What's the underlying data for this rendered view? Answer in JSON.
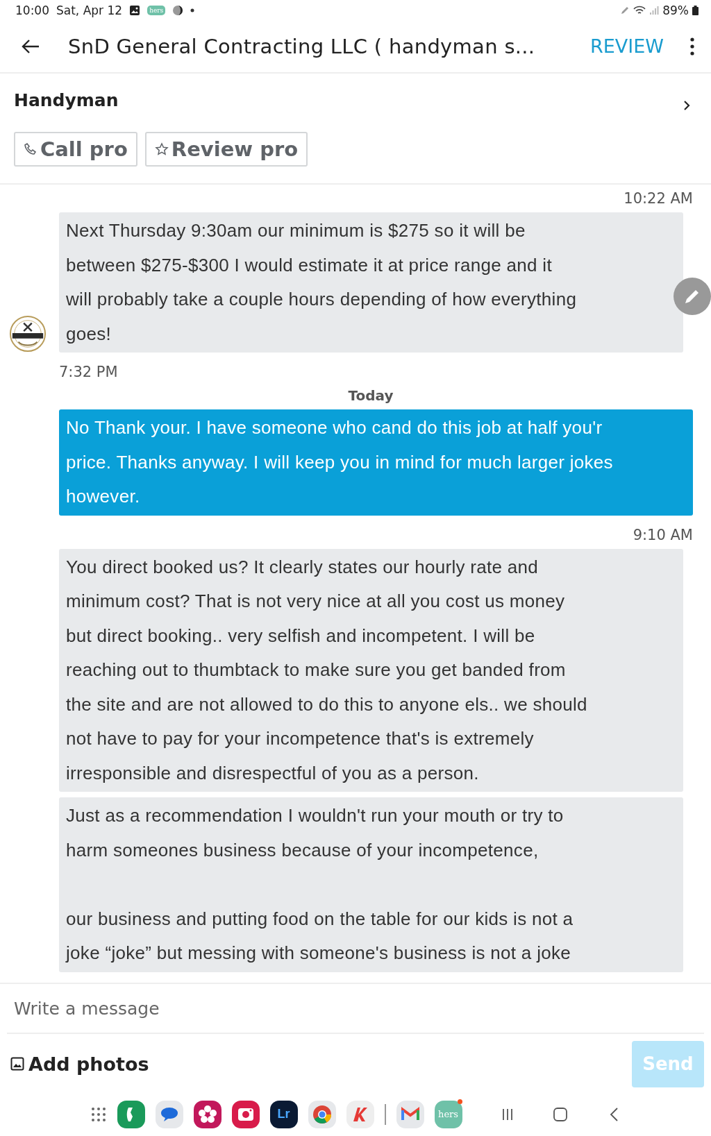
{
  "status_bar": {
    "time": "10:00",
    "date": "Sat, Apr 12",
    "app_badge": "hers",
    "battery": "89%"
  },
  "header": {
    "title": "SnD General Contracting LLC ( handyman s...",
    "action": "REVIEW"
  },
  "service": {
    "title": "Handyman"
  },
  "actions": [
    {
      "kind": "call",
      "label": "Call pro"
    },
    {
      "kind": "review",
      "label": "Review pro"
    }
  ],
  "messages": [
    {
      "kind": "time_right",
      "text": "10:22 AM"
    },
    {
      "kind": "bubble_in",
      "avatar": true,
      "text": "Next Thursday 9:30am our minimum is $275 so it will be\nbetween $275-$300 I would estimate it at price range and it\nwill probably take a couple hours depending of how everything\ngoes!"
    },
    {
      "kind": "time_left",
      "text": "7:32 PM"
    },
    {
      "kind": "day",
      "text": "Today"
    },
    {
      "kind": "bubble_out",
      "avatar": false,
      "text": "No Thank your. I have someone who cand do this job at half you'r\nprice. Thanks anyway. I will keep you in mind for much larger jokes\nhowever."
    },
    {
      "kind": "time_right",
      "text": "9:10 AM"
    },
    {
      "kind": "bubble_in",
      "avatar": false,
      "text": "You direct booked us? It clearly states our hourly rate and\nminimum cost? That is not very nice at all you cost us money\nbut direct booking.. very selfish and incompetent. I will be\nreaching out to thumbtack to make sure you get banded from\nthe site and are not allowed to do this to anyone els.. we should\nnot have to pay for your incompetence that's is extremely\nirresponsible and disrespectful of you as a person."
    },
    {
      "kind": "bubble_in",
      "avatar": false,
      "text": "Just as a recommendation I wouldn't run your mouth or try to\nharm someones business because of your incompetence,\n\nour business and putting food on the table for our kids is not a\njoke “joke” but messing with someone's business is not a joke"
    }
  ],
  "composer": {
    "placeholder": "Write a message",
    "add_photos": "Add photos",
    "send": "Send",
    "send_disabled": true
  },
  "dock": [
    {
      "kind": "grid"
    },
    {
      "kind": "phone"
    },
    {
      "kind": "chat"
    },
    {
      "kind": "flower"
    },
    {
      "kind": "camera"
    },
    {
      "kind": "lr",
      "label": "Lr"
    },
    {
      "kind": "chrome"
    },
    {
      "kind": "k"
    },
    {
      "kind": "divider"
    },
    {
      "kind": "gmail"
    },
    {
      "kind": "hers",
      "label": "hers"
    },
    {
      "kind": "recents"
    },
    {
      "kind": "home"
    },
    {
      "kind": "back"
    }
  ]
}
